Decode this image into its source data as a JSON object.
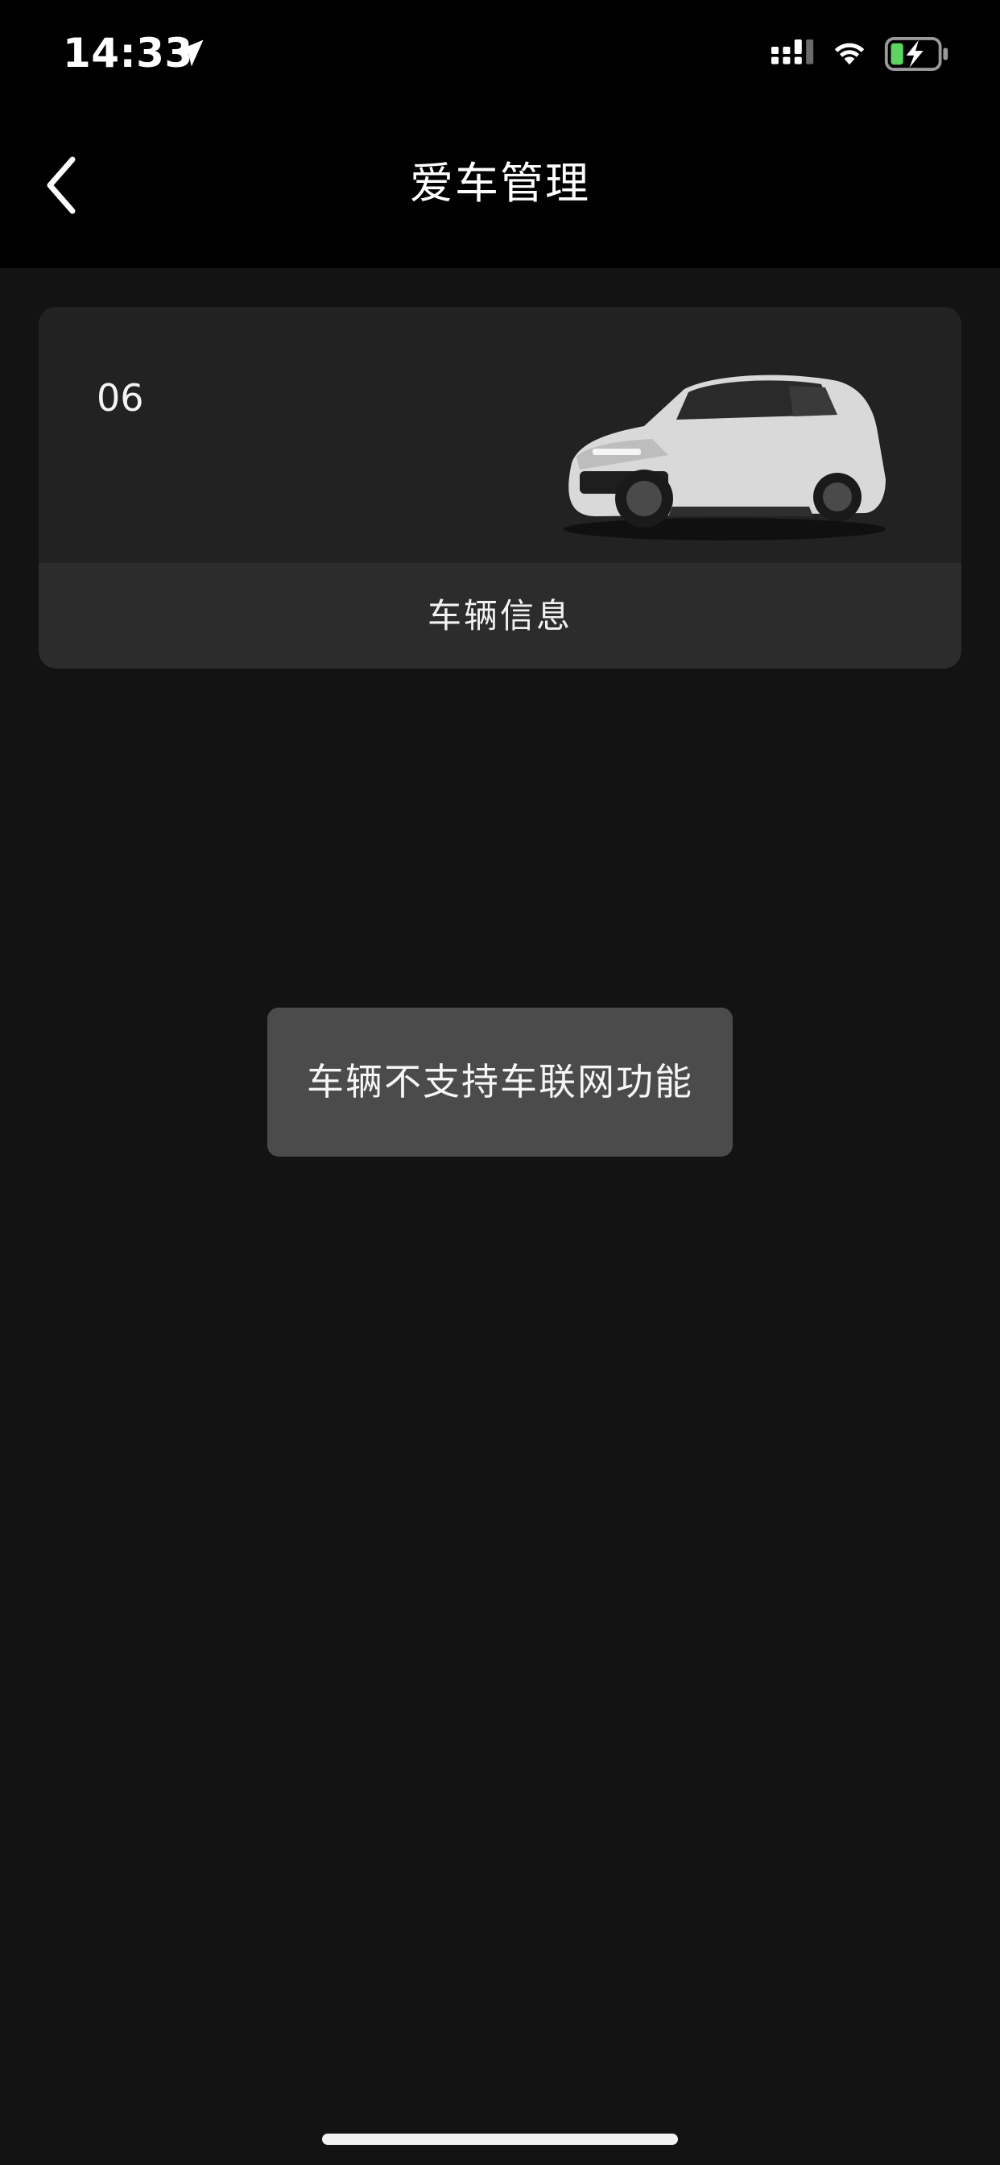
{
  "status_bar": {
    "time": "14:33",
    "icons": [
      "location-arrow-icon",
      "signal-icon",
      "wifi-icon",
      "battery-charging-icon"
    ],
    "battery_color": "#5fd35f"
  },
  "header": {
    "title": "爱车管理",
    "back_icon": "chevron-left-icon"
  },
  "vehicle_card": {
    "model": "06",
    "image": "white-suv-car-image",
    "info_button_label": "车辆信息"
  },
  "toast": {
    "message": "车辆不支持车联网功能"
  },
  "theme": {
    "background": "#131313",
    "header_background": "#000000",
    "card_background": "#222222",
    "card_footer_background": "#2c2c2c",
    "toast_background": "#4b4b4b",
    "text": "#ffffff"
  }
}
